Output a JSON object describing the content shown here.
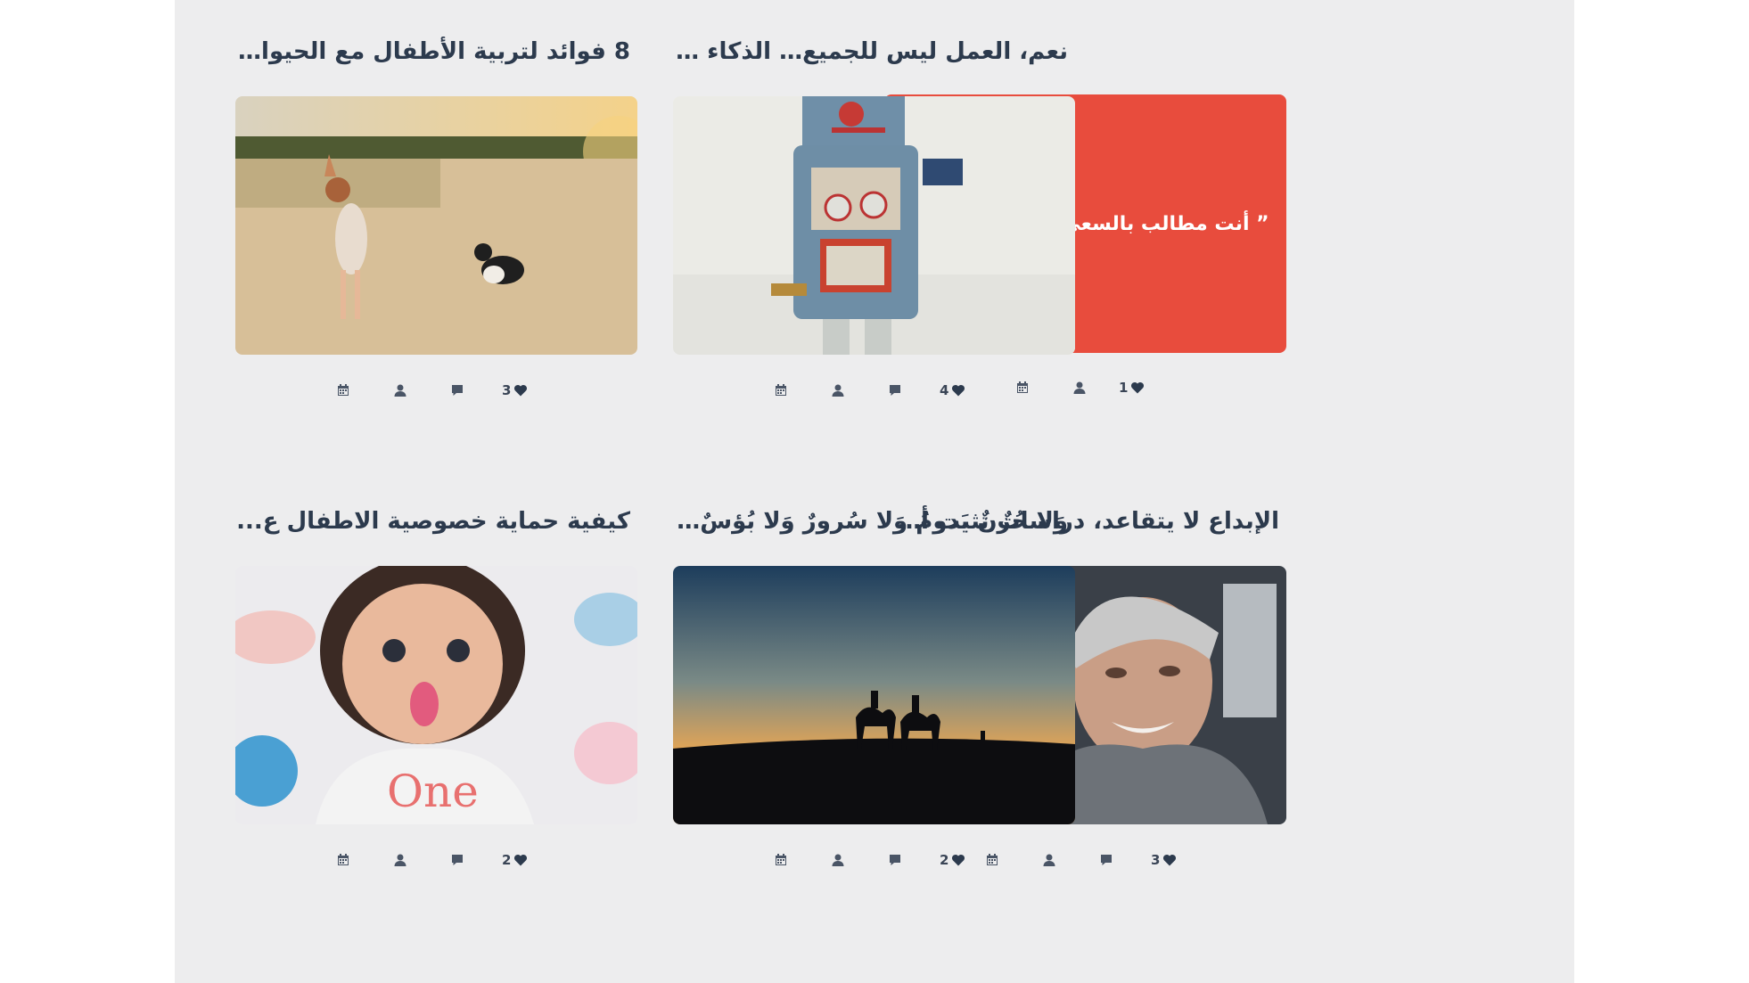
{
  "posts": [
    {
      "title": "نعم، العمل ليس للجميع… الذكاء ا...",
      "likes": "4",
      "image": "robot-toy"
    },
    {
      "title": "8 فوائد لتربية الأطفال مع الحيوانا...",
      "likes": "3",
      "image": "girl-dog-beach"
    },
    {
      "title": "",
      "quote": "” أنت مطالب بالسعي و ليس النتيجة ”",
      "likes": "1",
      "image": "quote-card",
      "quote_bg": "#e84c3d"
    },
    {
      "title": "الإبداع لا يتقاعد، دراساتٌ تثبت أن ا...",
      "likes": "3",
      "image": "old-woman-portrait"
    },
    {
      "title": "وَلا حُزنٌ يَدومُ وَلا سُرورٌ وَلا بُؤسٌ عَلَ...",
      "likes": "2",
      "image": "camels-sunset"
    },
    {
      "title": "كيفية حماية خصوصية الاطفال ع...",
      "likes": "2",
      "image": "baby-tongue"
    }
  ],
  "icons": [
    "calendar-icon",
    "user-icon",
    "comment-icon",
    "heart-icon"
  ]
}
